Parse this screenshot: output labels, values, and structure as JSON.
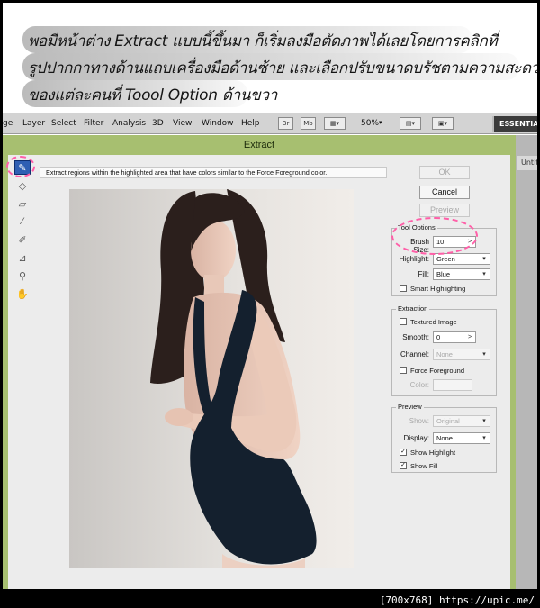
{
  "caption": {
    "lines": [
      "พอมีหน้าต่าง Extract แบบนี้ขึ้นมา ก็เริ่มลงมือตัดภาพได้เลยโดยการคลิกที่",
      "รูปปากกาทางด้านแถบเครื่องมือด้านซ้าย และเลือกปรับขนาดบรัชตามความสะดวก",
      "ของแต่ละคนที่ Toool Option ด้านขวา"
    ]
  },
  "menubar": {
    "items": [
      "ge",
      "Layer",
      "Select",
      "Filter",
      "Analysis",
      "3D",
      "View",
      "Window",
      "Help"
    ],
    "br": "Br",
    "mb": "Mb",
    "zoom": "50%",
    "workspace": "ESSENTIAL"
  },
  "background_tab": "Untit",
  "dialog": {
    "title": "Extract",
    "hint": "Extract regions within the highlighted area that have colors similar to the Force Foreground color.",
    "buttons": {
      "ok": "OK",
      "cancel": "Cancel",
      "preview": "Preview"
    },
    "tool_options": {
      "title": "Tool Options",
      "brush_size_label": "Brush Size:",
      "brush_size": "10",
      "highlight_label": "Highlight:",
      "highlight": "Green",
      "fill_label": "Fill:",
      "fill": "Blue",
      "smart_label": "Smart Highlighting"
    },
    "extraction": {
      "title": "Extraction",
      "textured_label": "Textured Image",
      "smooth_label": "Smooth:",
      "smooth": "0",
      "channel_label": "Channel:",
      "channel": "None",
      "force_label": "Force Foreground",
      "color_label": "Color:"
    },
    "preview_group": {
      "title": "Preview",
      "show_label": "Show:",
      "show": "Original",
      "display_label": "Display:",
      "display": "None",
      "show_highlight_label": "Show Highlight",
      "show_fill_label": "Show Fill"
    }
  },
  "watermark": "[700x768] https://upic.me/",
  "colors": {
    "accent_green": "#a7bf70",
    "highlight_mark": "#ff5fa8",
    "active_tool": "#2f5fb3"
  }
}
